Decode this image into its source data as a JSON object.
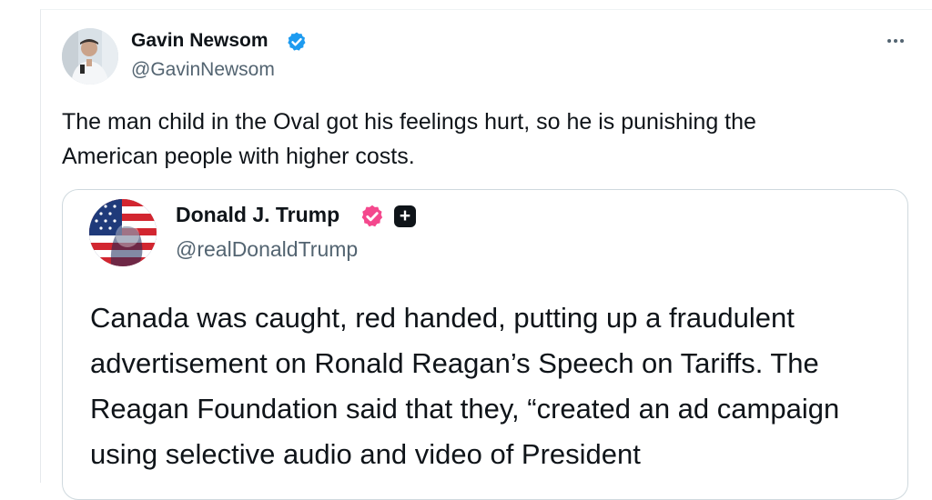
{
  "post": {
    "author": {
      "name": "Gavin Newsom",
      "handle": "@GavinNewsom",
      "avatar_icon": "profile-photo",
      "verified_badge": "blue-checkmark-icon",
      "verified_color": "#1d9bf0"
    },
    "more_icon": "more-horizontal-icon",
    "text": "The man child in the Oval got his feelings hurt, so he is punishing the American people with higher costs."
  },
  "quoted_post": {
    "author": {
      "name": "Donald J. Trump",
      "handle": "@realDonaldTrump",
      "avatar_icon": "profile-photo-flag",
      "verified_badge": "red-checkmark-icon",
      "verified_color": "#f4488d",
      "affiliate_badge_label": "+"
    },
    "text": "Canada was caught, red handed, putting up a fraudulent advertisement on Ronald Reagan’s Speech on Tariffs. The Reagan Foundation said that they, “created an ad campaign using selective audio and video of President"
  },
  "colors": {
    "text_primary": "#0f1419",
    "text_secondary": "#536471",
    "border": "#cfd9de"
  }
}
